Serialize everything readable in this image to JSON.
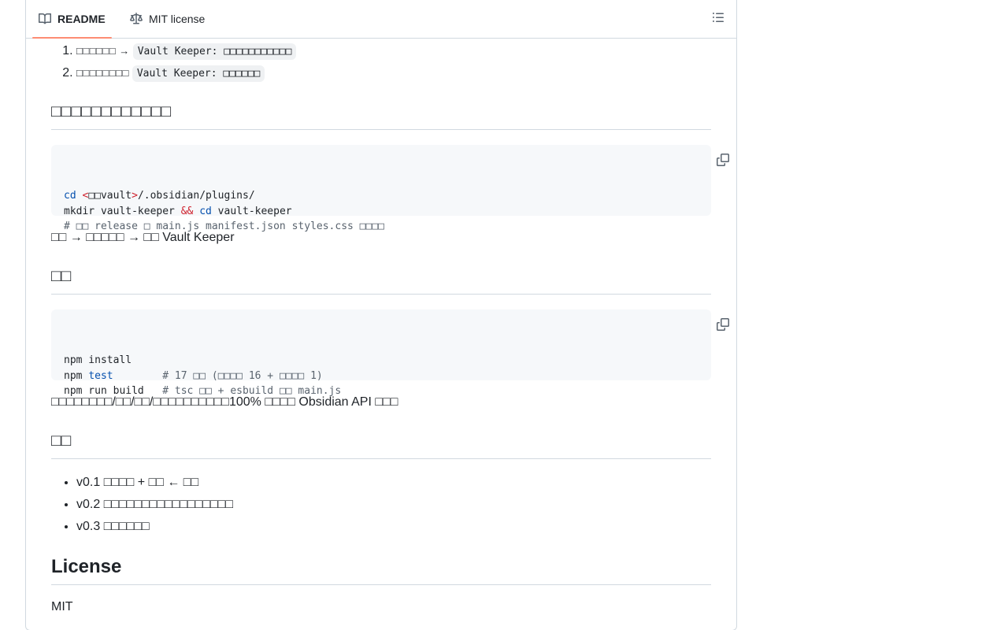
{
  "tabs": {
    "readme": "README",
    "license": "MIT license"
  },
  "install_steps": [
    {
      "text": "□□□□□□ →",
      "code": "Vault Keeper: □□□□□□□□□□□"
    },
    {
      "text": "□□□□□□□□",
      "code": "Vault Keeper: □□□□□□"
    }
  ],
  "manual_install": {
    "heading": "□□□□□□□□□□□□",
    "code_lines": [
      [
        {
          "t": "cd",
          "c": "kw"
        },
        {
          "t": " "
        },
        {
          "t": "<",
          "c": "op"
        },
        {
          "t": "□□vault"
        },
        {
          "t": ">",
          "c": "op"
        },
        {
          "t": "/.obsidian/plugins/"
        }
      ],
      [
        {
          "t": "mkdir vault-keeper "
        },
        {
          "t": "&&",
          "c": "op"
        },
        {
          "t": " "
        },
        {
          "t": "cd",
          "c": "kw"
        },
        {
          "t": " vault-keeper"
        }
      ],
      [
        {
          "t": "# □□ release □ main.js manifest.json styles.css □□□□",
          "c": "cm"
        }
      ]
    ],
    "note": "□□ → □□□□□ → □□ Vault Keeper"
  },
  "dev": {
    "heading": "□□",
    "code_lines": [
      [
        {
          "t": "npm install"
        }
      ],
      [
        {
          "t": "npm "
        },
        {
          "t": "test",
          "c": "kw"
        },
        {
          "t": "        "
        },
        {
          "t": "# 17 □□ (□□□□ 16 + □□□□ 1)",
          "c": "cm"
        }
      ],
      [
        {
          "t": "npm run build   "
        },
        {
          "t": "# tsc □□ + esbuild □□ main.js",
          "c": "cm"
        }
      ]
    ],
    "note": "□□□□□□□□/□□/□□/□□□□□□□□□□100% □□□□ Obsidian API □□□"
  },
  "roadmap": {
    "heading": "□□",
    "items": [
      "v0.1 □□□□ + □□ ← □□",
      "v0.2 □□□□□□□□□□□□□□□□□",
      "v0.3 □□□□□□"
    ]
  },
  "license": {
    "heading": "License",
    "text": "MIT"
  },
  "colors": {
    "accent_underline": "#fd8c73",
    "code_bg": "#f6f8fa",
    "keyword": "#0550ae",
    "operator": "#cf222e",
    "comment": "#59636e"
  }
}
